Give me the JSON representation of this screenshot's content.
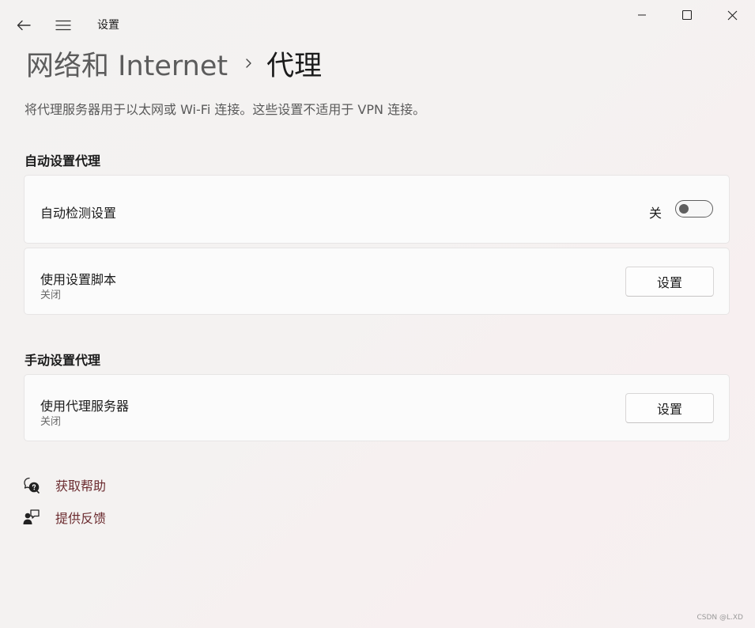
{
  "window": {
    "title": "设置",
    "back_icon": "back-arrow-icon",
    "menu_icon": "hamburger-menu-icon",
    "controls": [
      "minimize-icon",
      "maximize-icon",
      "close-icon"
    ]
  },
  "breadcrumb": {
    "parent": "网络和 Internet",
    "separator_icon": "chevron-right-icon",
    "current": "代理"
  },
  "description": "将代理服务器用于以太网或 Wi-Fi 连接。这些设置不适用于 VPN 连接。",
  "auto_section": {
    "title": "自动设置代理",
    "detect": {
      "label": "自动检测设置",
      "state_label": "关",
      "enabled": false
    },
    "script": {
      "label": "使用设置脚本",
      "status": "关闭",
      "button_label": "设置"
    }
  },
  "manual_section": {
    "title": "手动设置代理",
    "proxy_server": {
      "label": "使用代理服务器",
      "status": "关闭",
      "button_label": "设置"
    }
  },
  "links": {
    "help": {
      "label": "获取帮助",
      "icon": "help-chat-icon"
    },
    "feedback": {
      "label": "提供反馈",
      "icon": "feedback-icon"
    }
  },
  "watermark": "CSDN @L.XD",
  "colors": {
    "link": "#6b2b2f",
    "toggle_off": "#5f5f5f"
  }
}
